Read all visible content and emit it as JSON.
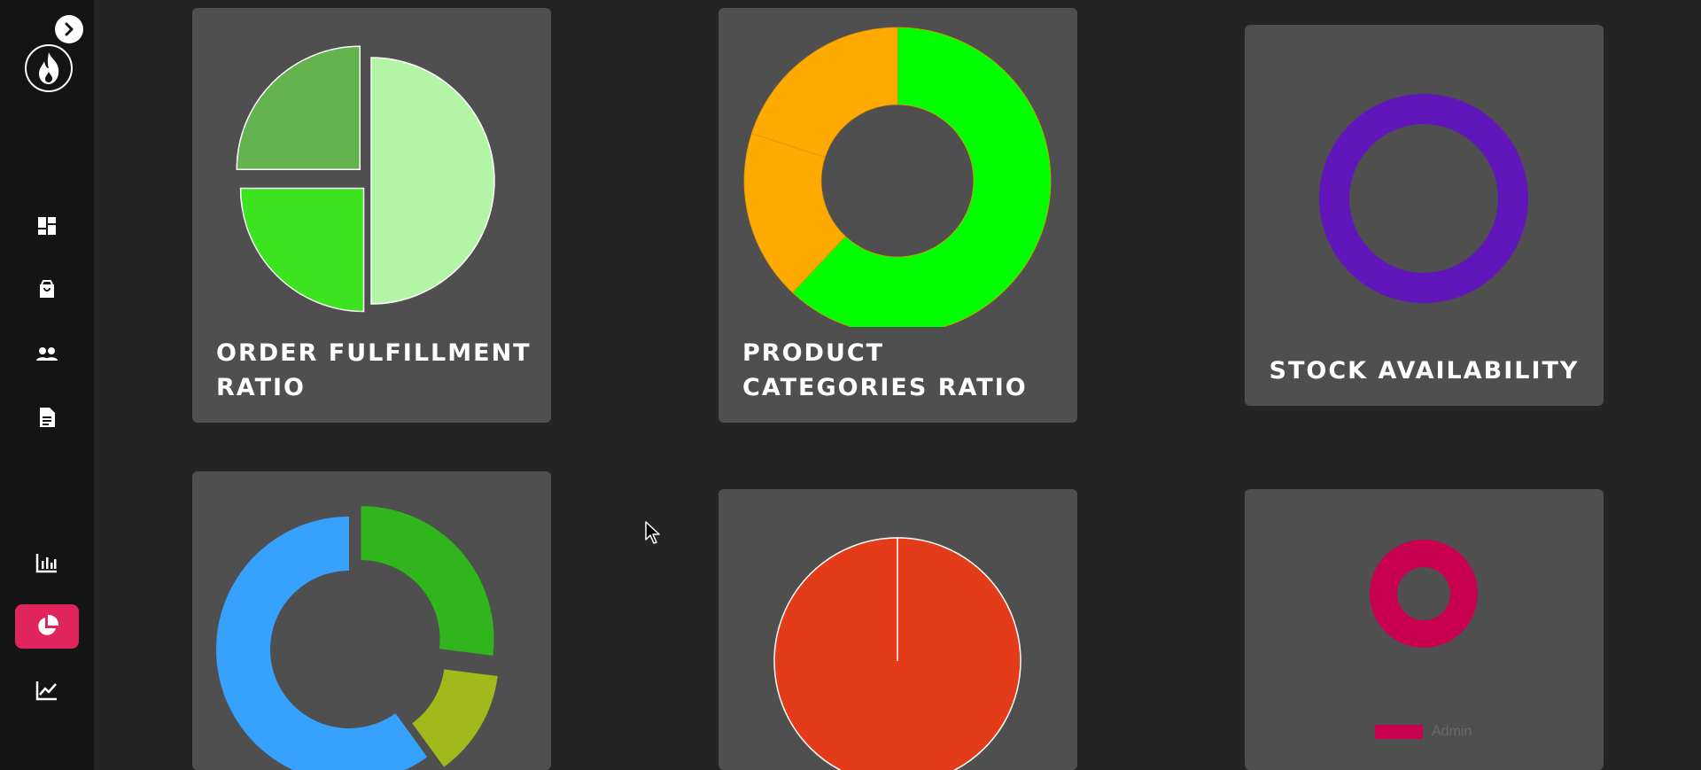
{
  "sidebar": {
    "nav": [
      {
        "icon": "dashboard-icon",
        "active": false
      },
      {
        "icon": "shopping-bag-icon",
        "active": false
      },
      {
        "icon": "users-icon",
        "active": false
      },
      {
        "icon": "document-icon",
        "active": false
      },
      {
        "icon": "bar-chart-icon",
        "active": false
      },
      {
        "icon": "pie-chart-icon",
        "active": true
      },
      {
        "icon": "line-chart-icon",
        "active": false
      }
    ],
    "active_color": "#e0245e"
  },
  "cards": {
    "order_fulfillment": {
      "title": "ORDER FULFILLMENT RATIO"
    },
    "product_categories": {
      "title": "PRODUCT CATEGORIES RATIO"
    },
    "stock_availability": {
      "title": "STOCK AVAILABILITY"
    },
    "legend": {
      "label": "Admin",
      "color": "#c8004f"
    }
  },
  "chart_data": [
    {
      "type": "pie",
      "title": "ORDER FULFILLMENT RATIO",
      "values": [
        50,
        25,
        25
      ],
      "colors": [
        "#b2f5a4",
        "#3ce41f",
        "#63b24e"
      ]
    },
    {
      "type": "pie",
      "title": "PRODUCT CATEGORIES RATIO",
      "values": [
        62,
        18,
        20
      ],
      "colors": [
        "#00ff00",
        "#ffaa00",
        "#ffaa00"
      ]
    },
    {
      "type": "pie",
      "title": "STOCK AVAILABILITY",
      "values": [
        100
      ],
      "colors": [
        "#6016bb"
      ]
    },
    {
      "type": "pie",
      "title": "",
      "values": [
        27,
        13,
        60
      ],
      "colors": [
        "#31b51d",
        "#a1b91a",
        "#37a2fe"
      ]
    },
    {
      "type": "pie",
      "title": "",
      "values": [
        100
      ],
      "colors": [
        "#e43c1a"
      ]
    },
    {
      "type": "pie",
      "title": "",
      "legend": [
        "Admin"
      ],
      "values": [
        100
      ],
      "colors": [
        "#c8004f"
      ]
    }
  ]
}
